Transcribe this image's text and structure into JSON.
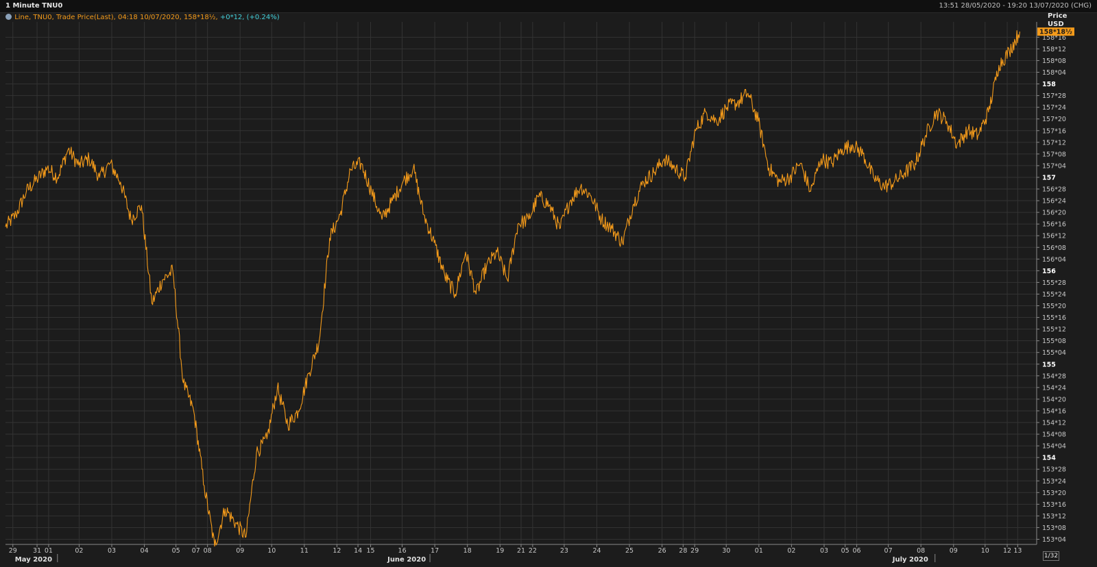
{
  "header": {
    "title": "1 Minute TNU0",
    "date_range": "13:51 28/05/2020 - 19:20 13/07/2020 (CHG)"
  },
  "legend": {
    "text": "Line, TNU0, Trade Price(Last), 04:18 10/07/2020, 158*18½,",
    "change": "+0*12, (+0.24%)",
    "icon": "globe-icon"
  },
  "axis": {
    "price_label": "Price",
    "currency_label": "USD",
    "last_price_tag": "158*18½",
    "fraction_tag": "1/32"
  },
  "colors": {
    "background": "#1c1c1c",
    "grid": "#333333",
    "line": "#f59b1a",
    "last_tag_bg": "#f59b1a",
    "change_text": "#44d2dc"
  },
  "chart_data": {
    "type": "line",
    "series": [
      {
        "x_ticks_index": [
          0,
          6.5,
          13,
          20,
          27.5,
          37,
          41,
          46,
          53,
          60,
          69,
          74,
          80,
          88,
          95,
          103,
          111,
          118,
          124,
          131,
          140,
          147,
          155,
          159,
          161,
          167,
          172,
          180,
          188,
          195,
          205,
          213,
          225,
          232,
          237,
          240
        ],
        "values": [
          156.47,
          156.6,
          156.85,
          156.98,
          157.1,
          157.0,
          157.3,
          157.13,
          157.2,
          157.0,
          157.15,
          156.95,
          156.55,
          156.7,
          155.65,
          155.9,
          156.0,
          154.8,
          154.5,
          153.7,
          153.05,
          153.45,
          153.3,
          153.15,
          154.05,
          154.2,
          154.75,
          154.35,
          154.5,
          154.9,
          155.25,
          156.35,
          156.6,
          157.08,
          157.15,
          156.85,
          156.55,
          156.75,
          156.95,
          157.1,
          156.6,
          156.3,
          155.95,
          155.75,
          156.2,
          155.75,
          156.05,
          156.2,
          155.9,
          156.5,
          156.55,
          156.8,
          156.7,
          156.45,
          156.75,
          156.9,
          156.8,
          156.55,
          156.45,
          156.3,
          156.7,
          156.95,
          157.05,
          157.2,
          157.1,
          157.0,
          157.5,
          157.7,
          157.6,
          157.75,
          157.8,
          157.9,
          157.6,
          157.1,
          156.95,
          157.0,
          157.15,
          156.85,
          157.2,
          157.15,
          157.3,
          157.35,
          157.25,
          157.0,
          156.9,
          156.95,
          157.05,
          157.15,
          157.45,
          157.7,
          157.6,
          157.35,
          157.5,
          157.45,
          157.7,
          158.2,
          158.35,
          158.56
        ]
      }
    ],
    "x_tick_labels": [
      "29",
      "31",
      "01",
      "02",
      "03",
      "04",
      "05",
      "07",
      "08",
      "09",
      "10",
      "11",
      "12",
      "14",
      "15",
      "16",
      "17",
      "18",
      "19",
      "21",
      "22",
      "23",
      "24",
      "25",
      "26",
      "28",
      "29",
      "30",
      "01",
      "02",
      "03",
      "05",
      "06",
      "07",
      "08",
      "09",
      "10",
      "12",
      "13"
    ],
    "x_tick_positions": [
      0.7,
      3.0,
      4.1,
      7.0,
      10.1,
      13.2,
      16.2,
      18.1,
      19.2,
      22.3,
      25.3,
      28.4,
      31.5,
      33.5,
      34.7,
      37.7,
      40.8,
      43.9,
      47.0,
      49.0,
      50.1,
      53.1,
      56.2,
      59.3,
      62.4,
      64.4,
      65.5,
      68.5,
      71.6,
      74.7,
      77.8,
      79.8,
      80.9,
      83.9,
      87.0,
      90.1,
      93.1,
      95.2,
      96.2
    ],
    "x_month_labels": [
      "May 2020",
      "June 2020",
      "July 2020"
    ],
    "x_month_positions": [
      0.9,
      36.3,
      84.3
    ],
    "x_range": [
      0,
      98
    ],
    "y_ticks": [
      153.125,
      153.25,
      153.375,
      153.5,
      153.625,
      153.75,
      153.875,
      154,
      154.125,
      154.25,
      154.375,
      154.5,
      154.625,
      154.75,
      154.875,
      155,
      155.125,
      155.25,
      155.375,
      155.5,
      155.625,
      155.75,
      155.875,
      156,
      156.125,
      156.25,
      156.375,
      156.5,
      156.625,
      156.75,
      156.875,
      157,
      157.125,
      157.25,
      157.375,
      157.5,
      157.625,
      157.75,
      157.875,
      158,
      158.125,
      158.25,
      158.375,
      158.5
    ],
    "y_tick_labels": [
      "153*04",
      "153*08",
      "153*12",
      "153*16",
      "153*20",
      "153*24",
      "153*28",
      "154",
      "154*04",
      "154*08",
      "154*12",
      "154*16",
      "154*20",
      "154*24",
      "154*28",
      "155",
      "155*04",
      "155*08",
      "155*12",
      "155*16",
      "155*20",
      "155*24",
      "155*28",
      "156",
      "156*04",
      "156*08",
      "156*12",
      "156*16",
      "156*20",
      "156*24",
      "156*28",
      "157",
      "157*04",
      "157*08",
      "157*12",
      "157*16",
      "157*20",
      "157*24",
      "157*28",
      "158",
      "158*04",
      "158*08",
      "158*12",
      "158*16"
    ],
    "y_major": [
      154,
      155,
      156,
      157,
      158
    ],
    "ylim": [
      153.07,
      158.62
    ],
    "grid": true
  }
}
